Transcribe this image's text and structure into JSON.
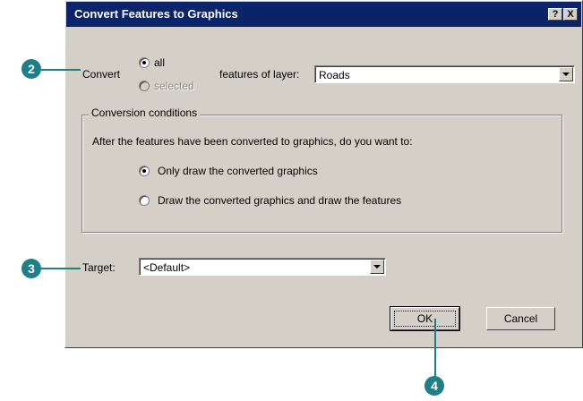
{
  "dialog": {
    "title": "Convert Features to Graphics",
    "help_button": "?",
    "close_button": "X"
  },
  "convert": {
    "label": "Convert",
    "option_all": "all",
    "option_selected": "selected",
    "selected_option": "all",
    "layer_label": "features of layer:",
    "layer_value": "Roads"
  },
  "conditions": {
    "group_title": "Conversion conditions",
    "question": "After the features have been converted to graphics, do you want to:",
    "option_only_graphics": "Only draw the converted graphics",
    "option_graphics_and_features": "Draw the converted graphics and draw the features",
    "selected_option": "only_graphics"
  },
  "target": {
    "label": "Target:",
    "value": "<Default>"
  },
  "buttons": {
    "ok": "OK",
    "cancel": "Cancel"
  },
  "callouts": {
    "step_2": "2",
    "step_3": "3",
    "step_4": "4",
    "color": "#1f7f86"
  },
  "colors": {
    "titlebar": "#0a246a",
    "dialog_face": "#d4d0c8"
  }
}
